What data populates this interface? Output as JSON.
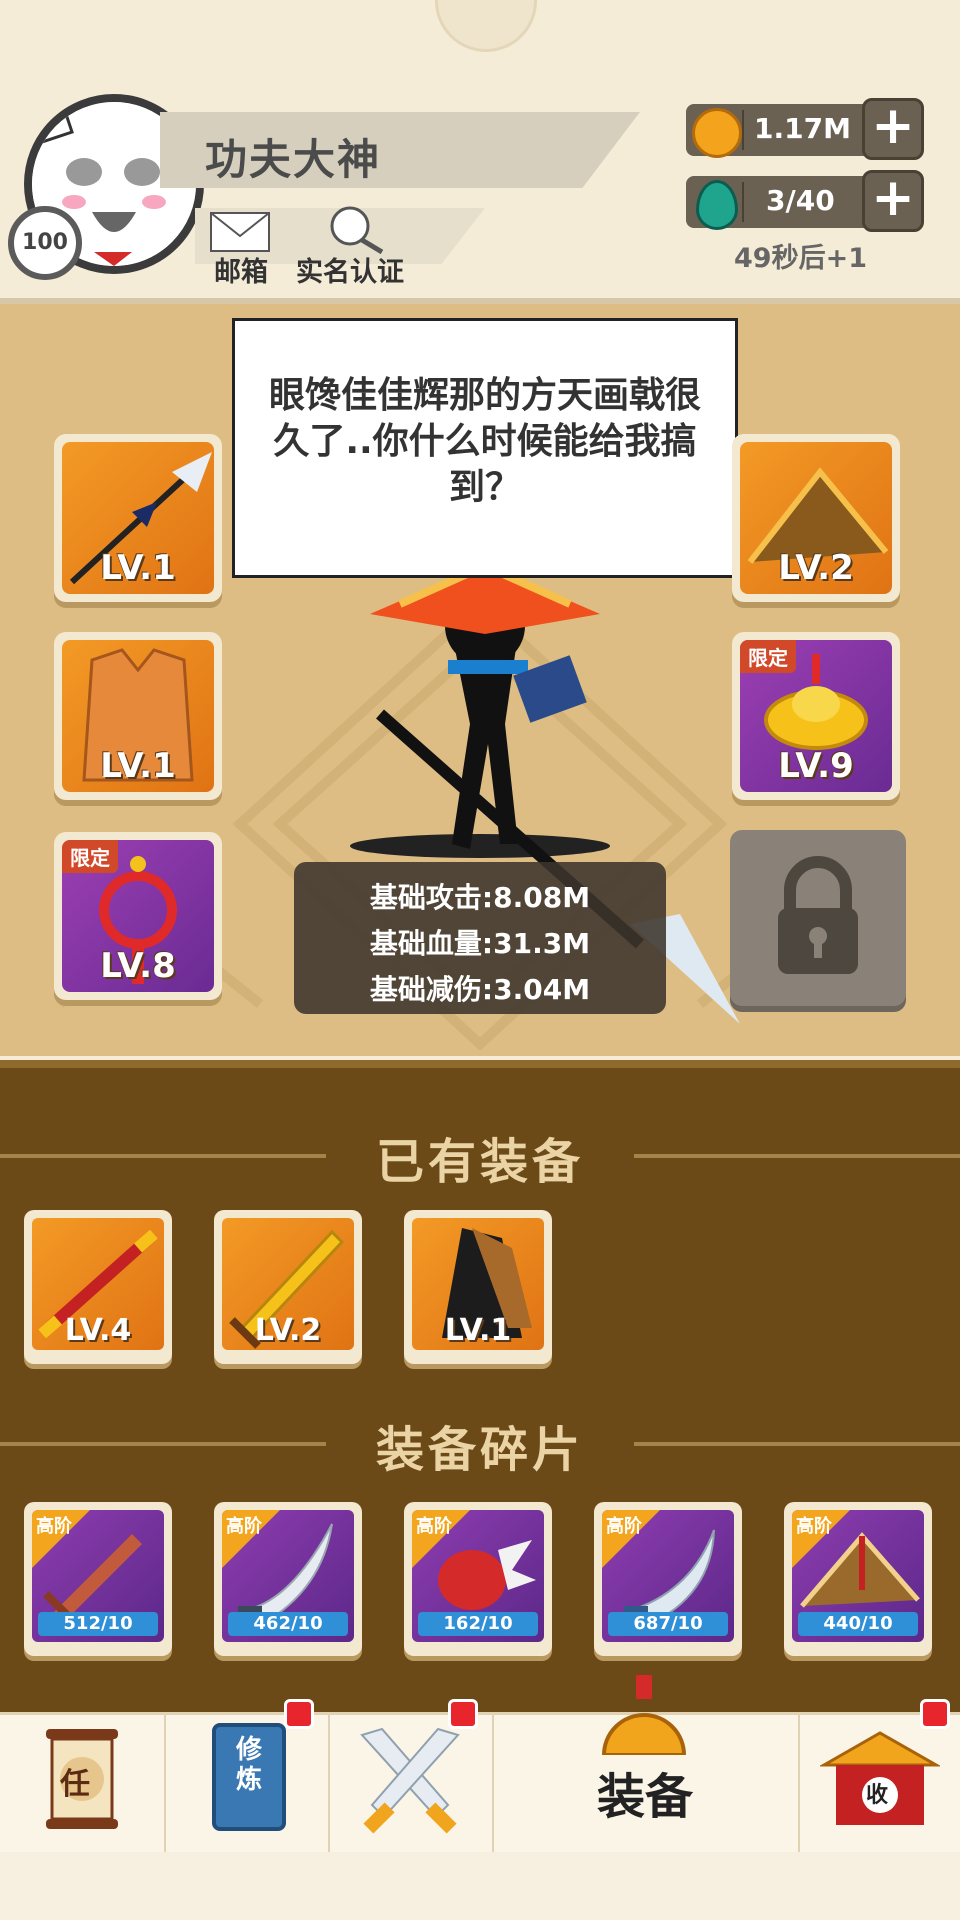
{
  "header": {
    "player_name": "功夫大神",
    "level": "100",
    "mail_label": "邮箱",
    "verify_label": "实名认证",
    "coins": "1.17M",
    "energy": "3/40",
    "regen_text": "49秒后+1",
    "plus_label": "+"
  },
  "scene": {
    "speech": "眼馋佳佳辉那的方天画戟很久了..你什么时候能给我搞到？",
    "slots_left": [
      {
        "label": "LV.1",
        "item": "halberd",
        "limited": false
      },
      {
        "label": "LV.1",
        "item": "armor",
        "limited": false
      },
      {
        "label": "LV.8",
        "item": "chinese-knot",
        "limited": true
      }
    ],
    "slots_right": [
      {
        "label": "LV.2",
        "item": "straw-hat",
        "limited": false
      },
      {
        "label": "LV.9",
        "item": "gold-ingot",
        "limited": true
      }
    ],
    "limited_tag": "限定",
    "stats": [
      "基础攻击:8.08M",
      "基础血量:31.3M",
      "基础减伤:3.04M"
    ]
  },
  "owned": {
    "title": "已有装备",
    "items": [
      {
        "label": "LV.4",
        "item": "staff"
      },
      {
        "label": "LV.2",
        "item": "golden-sword"
      },
      {
        "label": "LV.1",
        "item": "cloak"
      }
    ]
  },
  "fragments": {
    "title": "装备碎片",
    "tag": "高阶",
    "items": [
      {
        "count": "512/10",
        "item": "wooden-sword"
      },
      {
        "count": "462/10",
        "item": "saber"
      },
      {
        "count": "162/10",
        "item": "red-gauntlet"
      },
      {
        "count": "687/10",
        "item": "broadsword"
      },
      {
        "count": "440/10",
        "item": "straw-hat"
      }
    ]
  },
  "nav": {
    "tabs": [
      "任",
      "修炼",
      "",
      "装备",
      "收"
    ],
    "active_label": "装备"
  },
  "colors": {
    "orange_slot": "#e88120",
    "purple_slot": "#7a34a3",
    "panel_brown": "#6b4a18",
    "badge_red": "#e8242c"
  }
}
